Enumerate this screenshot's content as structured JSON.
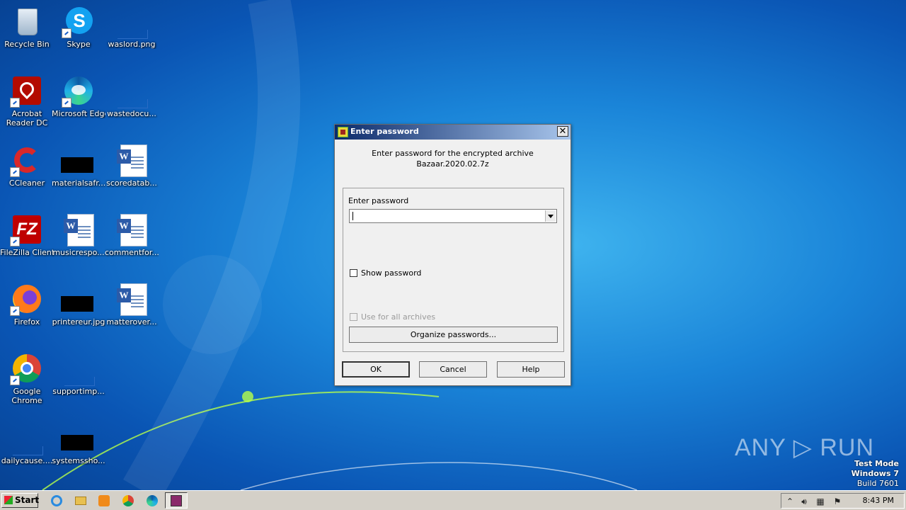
{
  "desktop": {
    "icons": [
      {
        "label": "Recycle Bin"
      },
      {
        "label": "Skype"
      },
      {
        "label": "waslord.png"
      },
      {
        "label": "Acrobat Reader DC"
      },
      {
        "label": "Microsoft Edge"
      },
      {
        "label": "wastedocu..."
      },
      {
        "label": "CCleaner"
      },
      {
        "label": "materialsafr..."
      },
      {
        "label": "scoredatab..."
      },
      {
        "label": "FileZilla Client"
      },
      {
        "label": "musicrespo..."
      },
      {
        "label": "commentfor..."
      },
      {
        "label": "Firefox"
      },
      {
        "label": "printereur.jpg"
      },
      {
        "label": "matterover..."
      },
      {
        "label": "Google Chrome"
      },
      {
        "label": "supportimp..."
      },
      {
        "label": "dailycause...."
      },
      {
        "label": "systemssho..."
      }
    ]
  },
  "dialog": {
    "title": "Enter password",
    "message_line1": "Enter password for the encrypted archive",
    "message_line2": "Bazaar.2020.02.7z",
    "password_label": "Enter password",
    "password_value": "",
    "show_password_label": "Show password",
    "use_for_all_label": "Use for all archives",
    "organize_button": "Organize passwords...",
    "ok_button": "OK",
    "cancel_button": "Cancel",
    "help_button": "Help",
    "close_glyph": "✕"
  },
  "taskbar": {
    "start_label": "Start",
    "clock": "8:43 PM"
  },
  "watermark": {
    "line1": "Test Mode",
    "line2": "Windows 7",
    "line3": "Build 7601",
    "brand": "ANY ▷ RUN"
  }
}
